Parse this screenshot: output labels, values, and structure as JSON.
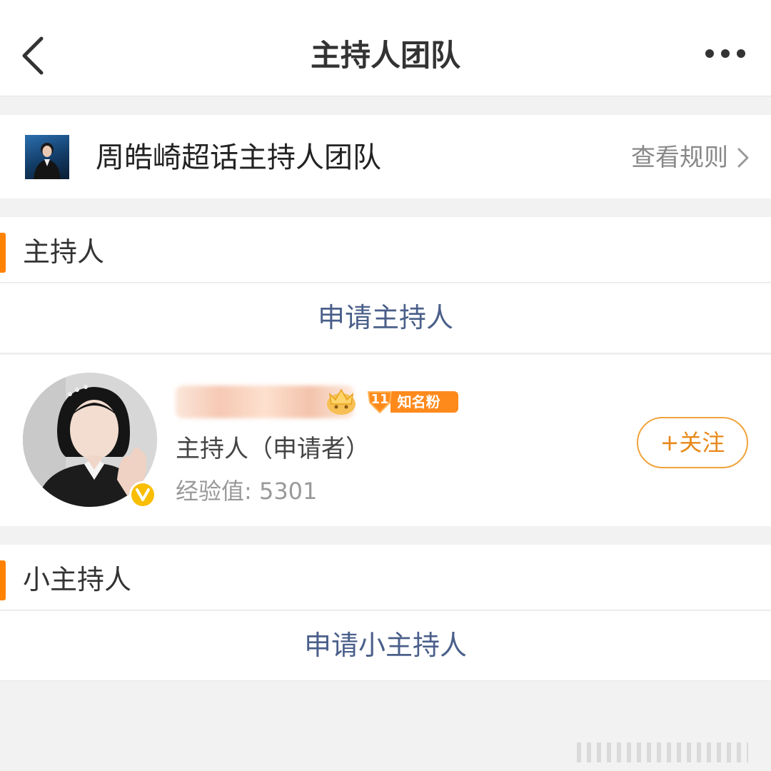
{
  "nav": {
    "title": "主持人团队",
    "back_icon": "chevron-left-icon",
    "more_icon": "more-dots-icon"
  },
  "team": {
    "name": "周皓崎超话主持人团队",
    "rules_label": "查看规则",
    "rules_icon": "chevron-right-icon"
  },
  "hosts_section": {
    "title": "主持人",
    "apply_label": "申请主持人",
    "members": [
      {
        "role": "主持人（申请者）",
        "experience": "经验值: 5301",
        "badge_level": "11",
        "badge_label": "知名粉丝",
        "follow_label": "+关注",
        "verified_icon": "verified-v-icon"
      }
    ]
  },
  "sub_hosts_section": {
    "title": "小主持人",
    "apply_label": "申请小主持人"
  },
  "colors": {
    "accent_orange": "#ff8200",
    "link_blue": "#4a5f8a",
    "follow_orange": "#e8891a"
  }
}
